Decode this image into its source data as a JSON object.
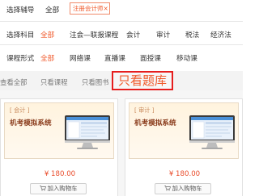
{
  "filters": {
    "selection": {
      "label": "选择辅导",
      "all": "全部",
      "tag": "注册会计师×"
    },
    "subject": {
      "label": "选择科目",
      "options": [
        "全部",
        "注会—联报课程",
        "会计",
        "审计",
        "税法",
        "经济法"
      ]
    },
    "course_form": {
      "label": "课程形式",
      "options": [
        "全部",
        "网络课",
        "直播课",
        "面授课",
        "移动课"
      ]
    }
  },
  "view_tabs": {
    "all": "查看全部",
    "courses": "只看课程",
    "books": "只看图书",
    "question_bank": "只看题库"
  },
  "products": [
    {
      "subject_tag": "[ 会计 ]",
      "title": "机考模拟系统",
      "price": "¥ 180.00",
      "cart_label": "加入购物车"
    },
    {
      "subject_tag": "[ 审计 ]",
      "title": "机考模拟系统",
      "price": "¥ 180.00",
      "cart_label": "加入购物车"
    }
  ],
  "colors": {
    "accent": "#f05a2c",
    "highlight_border": "#e61e1e",
    "price": "#e94b2a",
    "filter_bar_bg": "#f3f3f3"
  }
}
